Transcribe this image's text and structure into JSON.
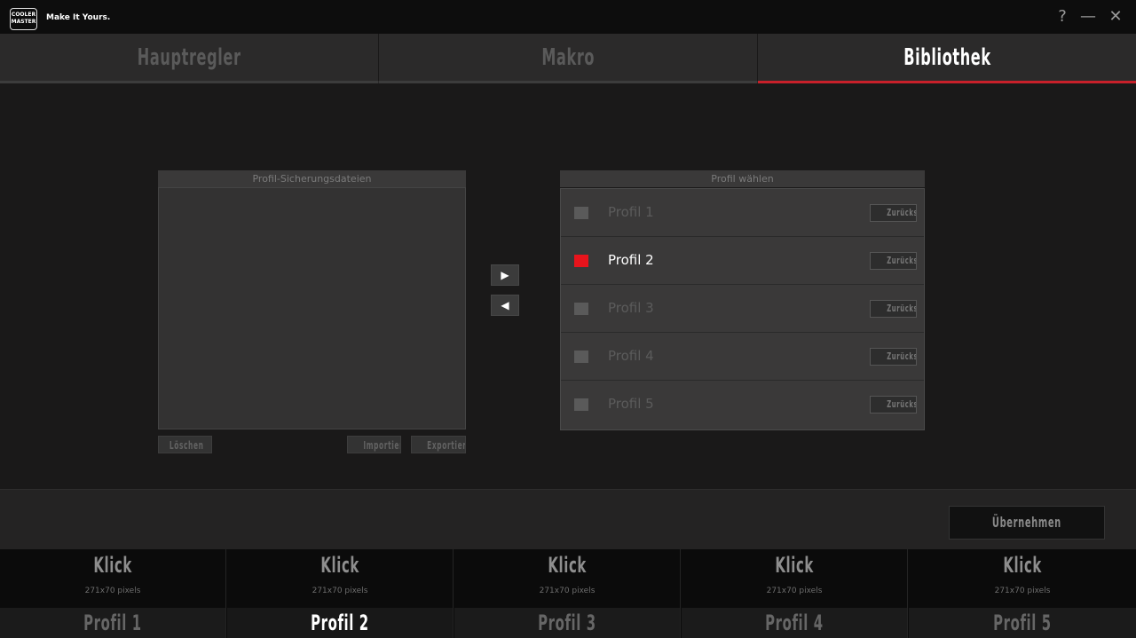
{
  "app": {
    "logo_text": "COOLER MASTER",
    "tagline": "Make It Yours.",
    "window_buttons": {
      "help": "?",
      "minimize": "—",
      "close": "✕"
    }
  },
  "tabs": [
    {
      "label": "Hauptregler",
      "active": false
    },
    {
      "label": "Makro",
      "active": false
    },
    {
      "label": "Bibliothek",
      "active": true
    }
  ],
  "backup_panel": {
    "title": "Profil-Sicherungsdateien",
    "buttons": {
      "delete": "Löschen",
      "import": "Importieren",
      "export": "Exportieren"
    }
  },
  "transfer": {
    "right_icon": "arrow-right-icon",
    "left_icon": "arrow-left-icon"
  },
  "profile_panel": {
    "title": "Profil wählen",
    "reset_label": "Zurücksetzen",
    "profiles": [
      {
        "name": "Profil 1",
        "checked": false
      },
      {
        "name": "Profil 2",
        "checked": true
      },
      {
        "name": "Profil 3",
        "checked": false
      },
      {
        "name": "Profil 4",
        "checked": false
      },
      {
        "name": "Profil 5",
        "checked": false
      }
    ]
  },
  "apply_button": "Übernehmen",
  "profile_slots": [
    {
      "title": "Klick",
      "subtitle": "271x70 pixels",
      "label": "Profil 1",
      "active": false
    },
    {
      "title": "Klick",
      "subtitle": "271x70 pixels",
      "label": "Profil 2",
      "active": true
    },
    {
      "title": "Klick",
      "subtitle": "271x70 pixels",
      "label": "Profil 3",
      "active": false
    },
    {
      "title": "Klick",
      "subtitle": "271x70 pixels",
      "label": "Profil 4",
      "active": false
    },
    {
      "title": "Klick",
      "subtitle": "271x70 pixels",
      "label": "Profil 5",
      "active": false
    }
  ],
  "colors": {
    "accent": "#e8141c",
    "tab_underline": "#c8202a",
    "background": "#1a1919"
  }
}
